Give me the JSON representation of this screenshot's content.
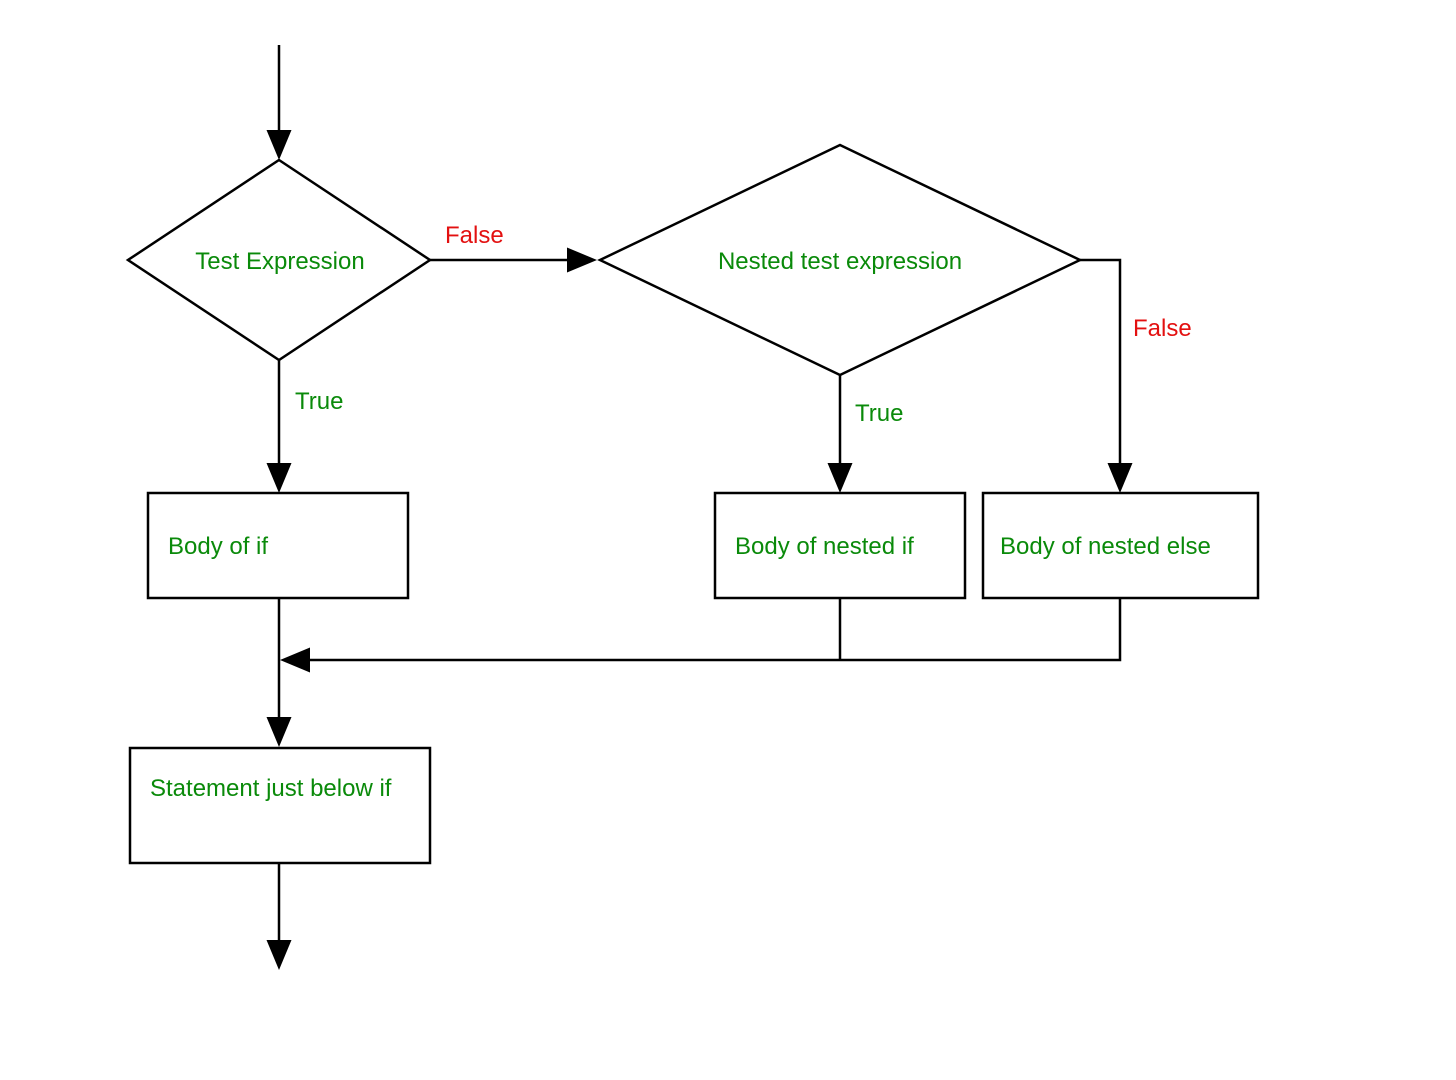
{
  "diagram": {
    "type": "flowchart",
    "topic": "Nested if-else control flow",
    "nodes": {
      "decision1": {
        "label": "Test Expression",
        "shape": "diamond"
      },
      "decision2": {
        "label": "Nested test expression",
        "shape": "diamond"
      },
      "box_if": {
        "label": "Body of if",
        "shape": "rectangle"
      },
      "box_nested_if": {
        "label": "Body of nested if",
        "shape": "rectangle"
      },
      "box_nested_else": {
        "label": "Body of nested else",
        "shape": "rectangle"
      },
      "box_after": {
        "label": "Statement just below if",
        "shape": "rectangle"
      }
    },
    "edges": {
      "decision1_true": {
        "label": "True",
        "color": "green"
      },
      "decision1_false": {
        "label": "False",
        "color": "red"
      },
      "decision2_true": {
        "label": "True",
        "color": "green"
      },
      "decision2_false": {
        "label": "False",
        "color": "red"
      }
    },
    "colors": {
      "node_text": "#0a8a0a",
      "true_label": "#0a8a0a",
      "false_label": "#e31010",
      "stroke": "#000000"
    }
  }
}
